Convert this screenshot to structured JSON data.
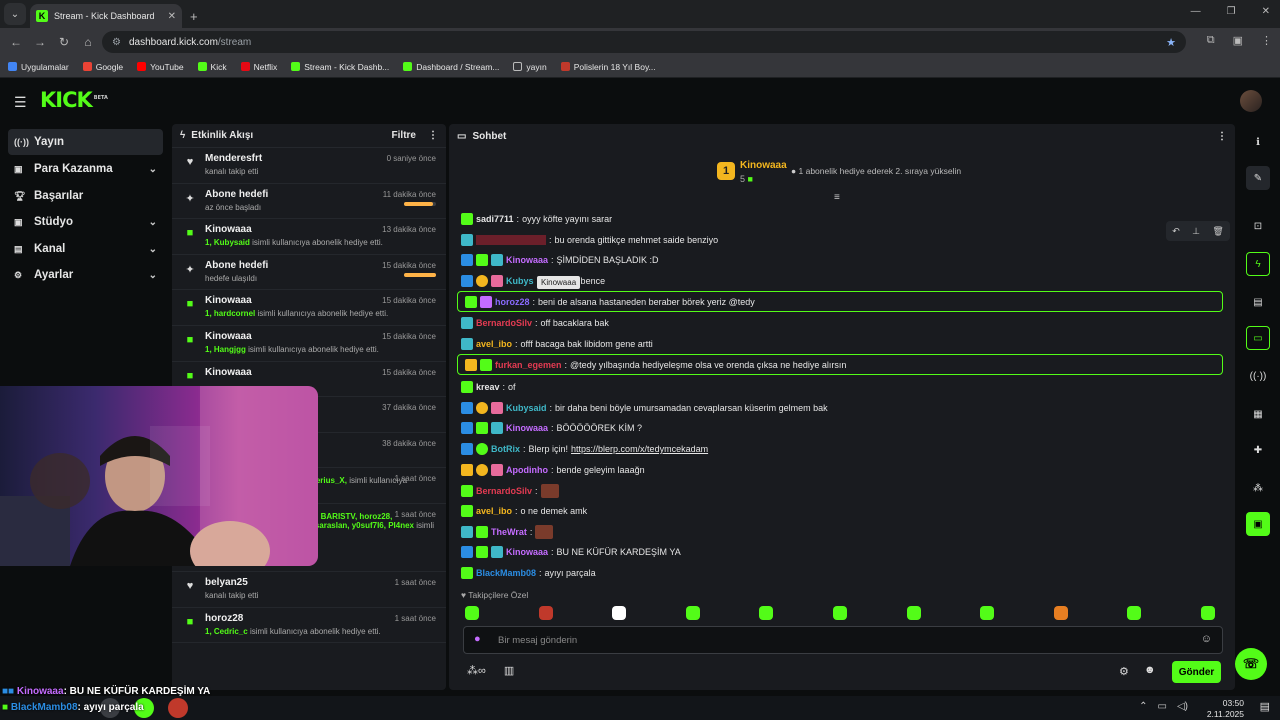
{
  "browser": {
    "tab_title": "Stream - Kick Dashboard",
    "url_host": "dashboard.kick.com",
    "url_path": "/stream",
    "bookmarks": [
      "Uygulamalar",
      "Google",
      "YouTube",
      "Kick",
      "Netflix",
      "Stream - Kick Dashb...",
      "Dashboard / Stream...",
      "yayın",
      "Polislerin 18 Yıl Boy..."
    ]
  },
  "brand": {
    "logo": "KICK",
    "beta": "BETA",
    "accent": "#53fc18"
  },
  "sidebar": {
    "items": [
      {
        "label": "Yayın",
        "icon": "broadcast-icon"
      },
      {
        "label": "Para Kazanma",
        "icon": "money-icon"
      },
      {
        "label": "Başarılar",
        "icon": "trophy-icon"
      },
      {
        "label": "Stüdyo",
        "icon": "studio-icon"
      },
      {
        "label": "Kanal",
        "icon": "channel-icon"
      },
      {
        "label": "Ayarlar",
        "icon": "gear-icon"
      }
    ]
  },
  "activity": {
    "title": "Etkinlik Akışı",
    "filter": "Filtre",
    "items": [
      {
        "name": "Menderesfrt",
        "time": "0 saniye önce",
        "sub": "kanalı takip etti"
      },
      {
        "name": "Abone hedefi",
        "time": "11 dakika önce",
        "sub": "az önce başladı",
        "progress": 0.9
      },
      {
        "name": "Kinowaaa",
        "time": "13 dakika önce",
        "hl": "1, Kubysaid",
        "sub": "isimli kullanıcıya abonelik hediye etti."
      },
      {
        "name": "Abone hedefi",
        "time": "15 dakika önce",
        "sub": "hedefe ulaşıldı",
        "progress": 1
      },
      {
        "name": "Kinowaaa",
        "time": "15 dakika önce",
        "hl": "1, hardcornel",
        "sub": "isimli kullanıcıya abonelik hediye etti."
      },
      {
        "name": "Kinowaaa",
        "time": "15 dakika önce",
        "hl": "1, Hangjgg",
        "sub": "isimli kullanıcıya abonelik hediye etti."
      },
      {
        "name": "Kinowaaa",
        "time": "15 dakika önce",
        "sub": ""
      },
      {
        "name": "",
        "time": "37 dakika önce",
        "sub": ""
      },
      {
        "name": "",
        "time": "38 dakika önce",
        "sub": ""
      },
      {
        "name": "",
        "time": "1 saat önce",
        "hl": "oxw, ShadowOBrave, s_21, Xerius_X,",
        "sub": "isimli kullanıcıya abonelik hediye etti."
      },
      {
        "name": "",
        "time": "1 saat önce",
        "hl": "10, exduall, zyna31, Sweno61, BARISTV, horoz28, sevmangotr1, argentawis, ensaraslan, y0suf7I6, PI4nex",
        "sub": "isimli kullanıcıya abonelik hediye etti."
      },
      {
        "name": "belyan25",
        "time": "1 saat önce",
        "sub": "kanalı takip etti"
      },
      {
        "name": "horoz28",
        "time": "1 saat önce",
        "hl": "1, Cedric_c",
        "sub": "isimli kullanıcıya abonelik hediye etti."
      }
    ]
  },
  "chat": {
    "title": "Sohbet",
    "pinned": {
      "rank": "1",
      "name": "Kinowaaa",
      "count": "5",
      "text": "1 abonelik hediye ederek 2. sıraya yükselin"
    },
    "tooltip": "Kinowaaa",
    "messages": [
      {
        "user": "sadi7711",
        "color": "#e6e6e6",
        "text": "oyyy köfte yayını sarar"
      },
      {
        "user": "",
        "color": "#e33b52",
        "text": "bu orenda gittikçe mehmet saide benziyo"
      },
      {
        "user": "Kinowaaa",
        "color": "#c46cff",
        "text": "ŞİMDİDEN BAŞLADIK :D"
      },
      {
        "user": "Kubys",
        "color": "#3fb8c8",
        "text": "o güzeldi bence"
      },
      {
        "user": "horoz28",
        "color": "#8a6bff",
        "text": "beni de alsana hastaneden beraber börek yeriz @tedy"
      },
      {
        "user": "BernardoSilv",
        "color": "#e33b52",
        "text": "off bacaklara bak"
      },
      {
        "user": "avel_ibo",
        "color": "#f3b61f",
        "text": "offf bacaga bak libidom gene artti"
      },
      {
        "user": "furkan_egemen",
        "color": "#e33b52",
        "text": "@tedy yılbaşında hediyeleşme olsa ve orenda çıksa ne hediye alırsın"
      },
      {
        "user": "kreav",
        "color": "#e6e6e6",
        "text": "of"
      },
      {
        "user": "Kubysaid",
        "color": "#3fb8c8",
        "text": "bir daha beni böyle umursamadan cevaplarsan küserim gelmem bak"
      },
      {
        "user": "Kinowaaa",
        "color": "#c46cff",
        "text": "BÖÖÖÖÖREK KİM ?"
      },
      {
        "user": "BotRix",
        "color": "#3fb8c8",
        "text": "Blerp için!",
        "link": "https://blerp.com/x/tedymcekadam"
      },
      {
        "user": "Apodinho",
        "color": "#c46cff",
        "text": "bende geleyim laaağn"
      },
      {
        "user": "BernardoSilv",
        "color": "#e33b52",
        "text": ""
      },
      {
        "user": "avel_ibo",
        "color": "#f3b61f",
        "text": "o ne demek amk"
      },
      {
        "user": "TheWrat",
        "color": "#c46cff",
        "text": ""
      },
      {
        "user": "Kinowaaa",
        "color": "#c46cff",
        "text": "BU NE KÜFÜR KARDEŞİM YA"
      },
      {
        "user": "BlackMamb08",
        "color": "#2b8de3",
        "text": "ayıyı parçala"
      }
    ],
    "followers_label": "Takipçilere Özel",
    "input_placeholder": "Bir mesaj gönderin",
    "send": "Gönder"
  },
  "overlay": {
    "line1_user": "Kinowaaa",
    "line1_text": ": BU NE KÜFÜR KARDEŞİM YA",
    "line2_user": "BlackMamb08",
    "line2_text": ": ayıyı parçala"
  },
  "taskbar": {
    "time": "03:50",
    "date": "2.11.2025"
  }
}
